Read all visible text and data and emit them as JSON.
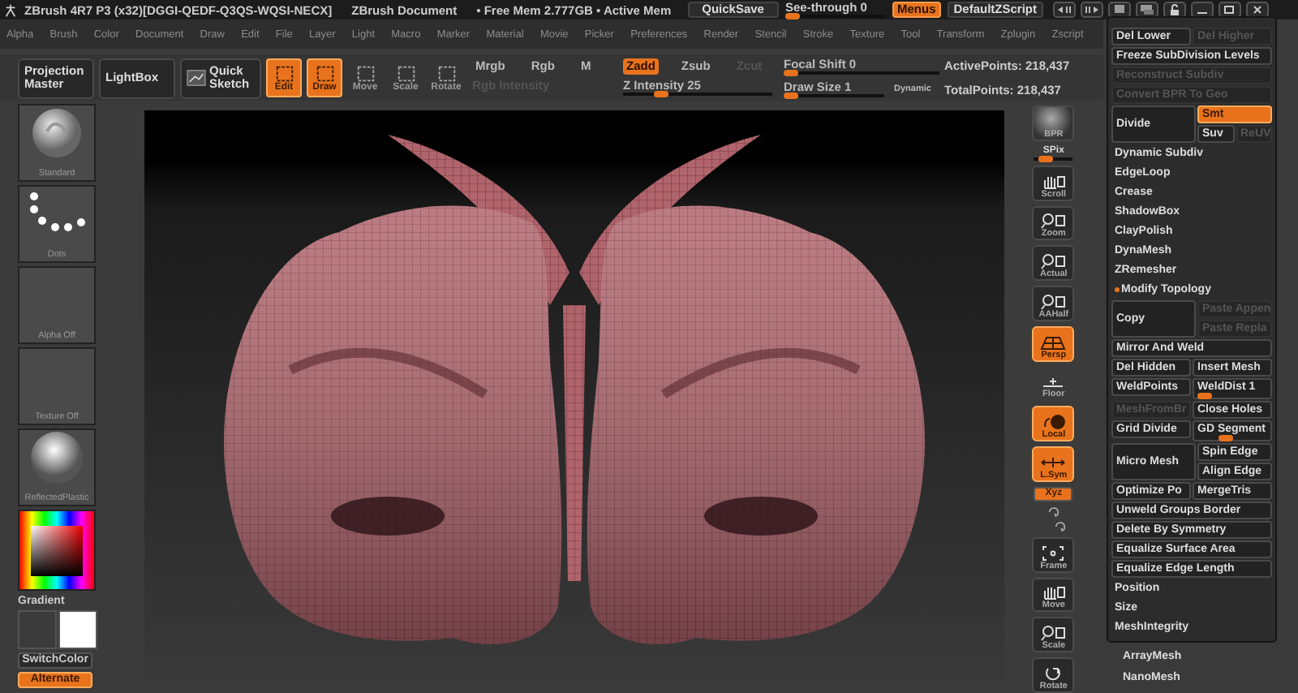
{
  "title_bar": {
    "app_title": "ZBrush 4R7 P3 (x32)[DGGI-QEDF-Q3QS-WQSI-NECX]",
    "document": "ZBrush Document",
    "memory": "• Free Mem 2.777GB • Active Mem",
    "quicksave": "QuickSave",
    "see_through": {
      "label": "See-through",
      "value": "0",
      "level": 0.08
    },
    "menus": {
      "label": "Menus",
      "on": true
    },
    "script": "DefaultZScript"
  },
  "menu_bar": [
    "Alpha",
    "Brush",
    "Color",
    "Document",
    "Draw",
    "Edit",
    "File",
    "Layer",
    "Light",
    "Macro",
    "Marker",
    "Material",
    "Movie",
    "Picker",
    "Preferences",
    "Render",
    "Stencil",
    "Stroke",
    "Texture",
    "Tool",
    "Transform",
    "Zplugin",
    "Zscript"
  ],
  "toolbar": {
    "large_buttons": [
      {
        "label": "Projection Master"
      },
      {
        "label": "LightBox"
      },
      {
        "label": "Quick Sketch"
      }
    ],
    "modes": [
      {
        "label": "Edit",
        "on": true
      },
      {
        "label": "Draw",
        "on": true
      },
      {
        "label": "Move",
        "on": false
      },
      {
        "label": "Scale",
        "on": false
      },
      {
        "label": "Rotate",
        "on": false
      }
    ],
    "color_modes": [
      {
        "label": "Mrgb",
        "on": false
      },
      {
        "label": "Rgb",
        "on": false
      },
      {
        "label": "M",
        "on": false
      }
    ],
    "rgb_intensity": {
      "label": "Rgb Intensity",
      "disabled": true
    },
    "z_modes": [
      {
        "label": "Zadd",
        "on": true,
        "disabled": false
      },
      {
        "label": "Zsub",
        "on": false,
        "disabled": false
      },
      {
        "label": "Zcut",
        "on": false,
        "disabled": true
      }
    ],
    "z_intensity": {
      "label": "Z Intensity",
      "value": "25",
      "level": 0.25
    },
    "focal_shift": {
      "label": "Focal Shift",
      "value": "0",
      "level": 0.05
    },
    "draw_size": {
      "label": "Draw Size",
      "value": "1",
      "level": 0.08
    },
    "dynamic": "Dynamic",
    "stats": [
      {
        "label": "ActivePoints:",
        "value": "218,437"
      },
      {
        "label": "TotalPoints:",
        "value": "218,437"
      }
    ]
  },
  "left_shelf": {
    "thumbnails": [
      {
        "label": "Standard",
        "kind": "brush"
      },
      {
        "label": "Dots",
        "kind": "stroke"
      },
      {
        "label": "Alpha Off",
        "kind": "empty"
      },
      {
        "label": "Texture Off",
        "kind": "empty"
      },
      {
        "label": "ReflectedPlastic",
        "kind": "material"
      }
    ],
    "gradient": "Gradient",
    "switch_color": "SwitchColor",
    "alternate": {
      "label": "Alternate",
      "on": true
    }
  },
  "right_shelf": [
    {
      "label": "BPR",
      "kind": "sphere"
    },
    {
      "label": "SPix",
      "kind": "slider",
      "level": 0.3
    },
    {
      "label": "Scroll",
      "kind": "button",
      "on": false
    },
    {
      "label": "Zoom",
      "kind": "button",
      "on": false
    },
    {
      "label": "Actual",
      "kind": "button",
      "on": false
    },
    {
      "label": "AAHalf",
      "kind": "button",
      "on": false
    },
    {
      "label": "Persp",
      "kind": "button",
      "on": true
    },
    {
      "label": "Floor",
      "kind": "plain"
    },
    {
      "label": "Local",
      "kind": "button",
      "on": true
    },
    {
      "label": "L.Sym",
      "kind": "button",
      "on": true
    },
    {
      "label": "Xyz",
      "kind": "small",
      "on": true
    },
    {
      "kind": "axis"
    },
    {
      "label": "Frame",
      "kind": "button",
      "on": false
    },
    {
      "label": "Move",
      "kind": "button",
      "on": false
    },
    {
      "label": "Scale",
      "kind": "button",
      "on": false
    },
    {
      "label": "Rotate",
      "kind": "button",
      "on": false
    }
  ],
  "right_panel": {
    "rows": [
      {
        "kind": "pair",
        "items": [
          {
            "kind": "button",
            "label": "Del Lower",
            "disabled": false
          },
          {
            "kind": "button",
            "label": "Del Higher",
            "disabled": true
          }
        ]
      },
      {
        "kind": "full",
        "label": "Freeze SubDivision Levels",
        "disabled": false
      },
      {
        "kind": "full",
        "label": "Reconstruct Subdiv",
        "disabled": true
      },
      {
        "kind": "full",
        "label": "Convert BPR To Geo",
        "disabled": true
      },
      {
        "kind": "divide",
        "label": "Divide",
        "options": [
          {
            "label": "Smt",
            "on": true,
            "disabled": false
          },
          {
            "label": "Suv",
            "on": false,
            "disabled": false
          },
          {
            "label": "ReUV",
            "on": false,
            "disabled": true
          }
        ]
      },
      {
        "kind": "header",
        "label": "Dynamic Subdiv",
        "expanded": false
      },
      {
        "kind": "header",
        "label": "EdgeLoop",
        "expanded": false
      },
      {
        "kind": "header",
        "label": "Crease",
        "expanded": false
      },
      {
        "kind": "header",
        "label": "ShadowBox",
        "expanded": false
      },
      {
        "kind": "header",
        "label": "ClayPolish",
        "expanded": false
      },
      {
        "kind": "header",
        "label": "DynaMesh",
        "expanded": false
      },
      {
        "kind": "header",
        "label": "ZRemesher",
        "expanded": false
      },
      {
        "kind": "header",
        "label": "Modify Topology",
        "expanded": true
      },
      {
        "kind": "copy",
        "label": "Copy",
        "options": [
          {
            "label": "Paste Appen",
            "disabled": true
          },
          {
            "label": "Paste Repla",
            "disabled": true
          }
        ]
      },
      {
        "kind": "full",
        "label": "Mirror And Weld",
        "disabled": false
      },
      {
        "kind": "pair",
        "items": [
          {
            "kind": "button",
            "label": "Del Hidden",
            "disabled": false
          },
          {
            "kind": "button",
            "label": "Insert Mesh",
            "disabled": false
          }
        ]
      },
      {
        "kind": "pair",
        "items": [
          {
            "kind": "button",
            "label": "WeldPoints",
            "disabled": false
          },
          {
            "kind": "slider",
            "label": "WeldDist 1",
            "level": 0.1
          }
        ]
      },
      {
        "kind": "pair",
        "items": [
          {
            "kind": "button",
            "label": "MeshFromBr",
            "disabled": true
          },
          {
            "kind": "button",
            "label": "Close Holes",
            "disabled": false
          }
        ]
      },
      {
        "kind": "pair",
        "items": [
          {
            "kind": "button",
            "label": "Grid Divide",
            "disabled": false
          },
          {
            "kind": "slider",
            "label": "GD Segment",
            "level": 0.4
          }
        ]
      },
      {
        "kind": "split",
        "label": "Micro Mesh",
        "options": [
          {
            "label": "Spin Edge"
          },
          {
            "label": "Align Edge"
          }
        ]
      },
      {
        "kind": "pair",
        "items": [
          {
            "kind": "button",
            "label": "Optimize Po",
            "disabled": false
          },
          {
            "kind": "button",
            "label": "MergeTris",
            "disabled": false
          }
        ]
      },
      {
        "kind": "full",
        "label": "Unweld Groups Border",
        "disabled": false
      },
      {
        "kind": "full",
        "label": "Delete By Symmetry",
        "disabled": false
      },
      {
        "kind": "full",
        "label": "Equalize Surface Area",
        "disabled": false
      },
      {
        "kind": "full",
        "label": "Equalize Edge Length",
        "disabled": false
      },
      {
        "kind": "header",
        "label": "Position",
        "expanded": false
      },
      {
        "kind": "header",
        "label": "Size",
        "expanded": false
      },
      {
        "kind": "header",
        "label": "MeshIntegrity",
        "expanded": false
      }
    ],
    "below": [
      "ArrayMesh",
      "NanoMesh"
    ]
  }
}
